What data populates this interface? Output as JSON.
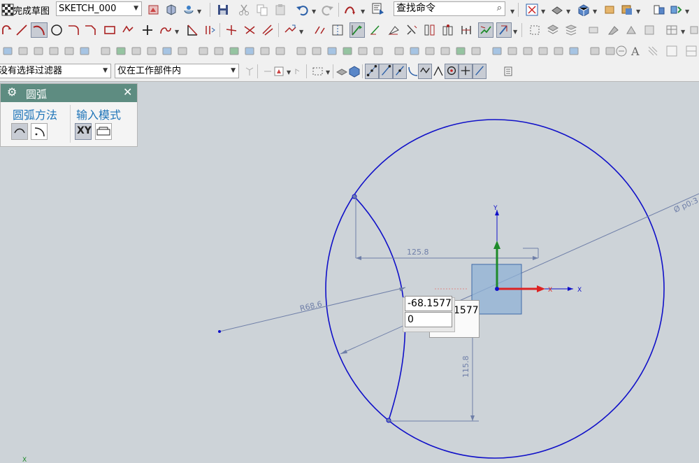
{
  "toolbar": {
    "finish_sketch_label": "完成草图",
    "sketch_name": "SKETCH_000",
    "command_search_placeholder": "查找命令",
    "selection_filter": "没有选择过滤器",
    "scope_filter": "仅在工作部件内"
  },
  "dialog": {
    "title": "圆弧",
    "group_method_label": "圆弧方法",
    "group_input_label": "输入模式",
    "xy_label": "XY"
  },
  "sketch": {
    "axis_x_label": "X",
    "axis_y_label": "Y",
    "dim_horizontal": "125.8",
    "dim_vertical": "115.8",
    "dim_radius": "R68.6",
    "dim_diameter": "Ø p0:3",
    "input_x_value": "-68.1577",
    "input_y_value": "0",
    "input_behind_value": "1577",
    "corner_axis_label": "X"
  },
  "colors": {
    "sketch_blue": "#1010c8",
    "dim_blue": "#6f7fa8",
    "dialog_header": "#5e8c81",
    "canvas_bg": "#cdd3d8"
  }
}
